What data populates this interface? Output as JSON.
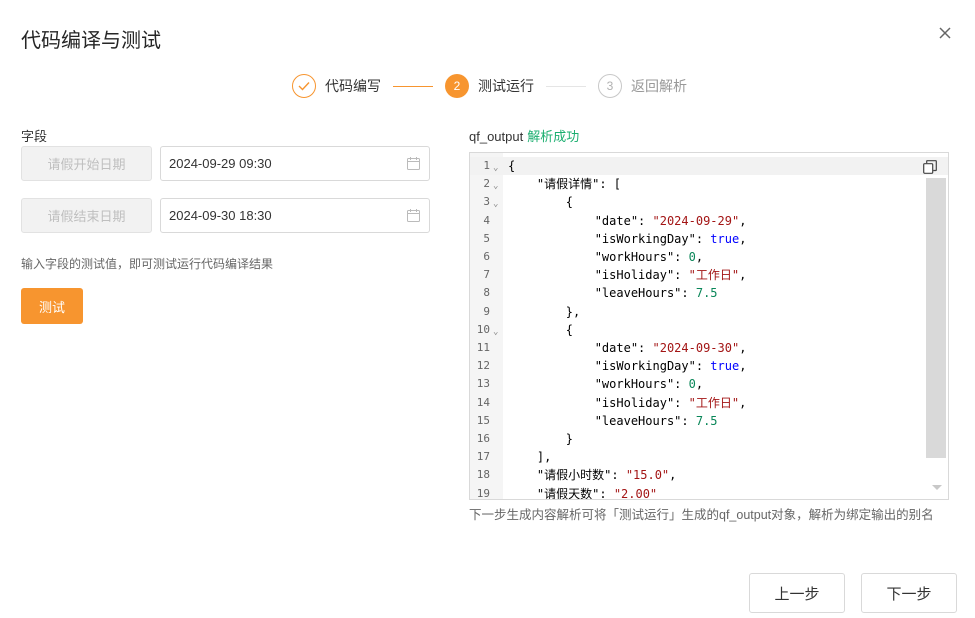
{
  "dialog": {
    "title": "代码编译与测试"
  },
  "steps": [
    {
      "label": "代码编写",
      "number": "1",
      "state": "done"
    },
    {
      "label": "测试运行",
      "number": "2",
      "state": "active"
    },
    {
      "label": "返回解析",
      "number": "3",
      "state": "todo"
    }
  ],
  "left": {
    "field_label": "字段",
    "params": [
      {
        "button": "请假开始日期",
        "value": "2024-09-29 09:30"
      },
      {
        "button": "请假结束日期",
        "value": "2024-09-30 18:30"
      }
    ],
    "hint": "输入字段的测试值，即可测试运行代码编译结果",
    "test_button": "测试"
  },
  "right": {
    "output_label": "qf_output",
    "status": "解析成功",
    "description": "下一步生成内容解析可将「测试运行」生成的qf_output对象，解析为绑定输出的别名"
  },
  "code_lines": [
    {
      "n": "1",
      "fold": true,
      "indent": 0,
      "parts": [
        [
          "p",
          "{"
        ]
      ]
    },
    {
      "n": "2",
      "fold": true,
      "indent": 1,
      "parts": [
        [
          "p",
          "\"请假详情\": ["
        ]
      ]
    },
    {
      "n": "3",
      "fold": true,
      "indent": 2,
      "parts": [
        [
          "p",
          "{"
        ]
      ]
    },
    {
      "n": "4",
      "fold": false,
      "indent": 3,
      "parts": [
        [
          "p",
          "\"date\": "
        ],
        [
          "s",
          "\"2024-09-29\""
        ],
        [
          "p",
          ","
        ]
      ]
    },
    {
      "n": "5",
      "fold": false,
      "indent": 3,
      "parts": [
        [
          "p",
          "\"isWorkingDay\": "
        ],
        [
          "k",
          "true"
        ],
        [
          "p",
          ","
        ]
      ]
    },
    {
      "n": "6",
      "fold": false,
      "indent": 3,
      "parts": [
        [
          "p",
          "\"workHours\": "
        ],
        [
          "d",
          "0"
        ],
        [
          "p",
          ","
        ]
      ]
    },
    {
      "n": "7",
      "fold": false,
      "indent": 3,
      "parts": [
        [
          "p",
          "\"isHoliday\": "
        ],
        [
          "s",
          "\"工作日\""
        ],
        [
          "p",
          ","
        ]
      ]
    },
    {
      "n": "8",
      "fold": false,
      "indent": 3,
      "parts": [
        [
          "p",
          "\"leaveHours\": "
        ],
        [
          "d",
          "7.5"
        ]
      ]
    },
    {
      "n": "9",
      "fold": false,
      "indent": 2,
      "parts": [
        [
          "p",
          "},"
        ]
      ]
    },
    {
      "n": "10",
      "fold": true,
      "indent": 2,
      "parts": [
        [
          "p",
          "{"
        ]
      ]
    },
    {
      "n": "11",
      "fold": false,
      "indent": 3,
      "parts": [
        [
          "p",
          "\"date\": "
        ],
        [
          "s",
          "\"2024-09-30\""
        ],
        [
          "p",
          ","
        ]
      ]
    },
    {
      "n": "12",
      "fold": false,
      "indent": 3,
      "parts": [
        [
          "p",
          "\"isWorkingDay\": "
        ],
        [
          "k",
          "true"
        ],
        [
          "p",
          ","
        ]
      ]
    },
    {
      "n": "13",
      "fold": false,
      "indent": 3,
      "parts": [
        [
          "p",
          "\"workHours\": "
        ],
        [
          "d",
          "0"
        ],
        [
          "p",
          ","
        ]
      ]
    },
    {
      "n": "14",
      "fold": false,
      "indent": 3,
      "parts": [
        [
          "p",
          "\"isHoliday\": "
        ],
        [
          "s",
          "\"工作日\""
        ],
        [
          "p",
          ","
        ]
      ]
    },
    {
      "n": "15",
      "fold": false,
      "indent": 3,
      "parts": [
        [
          "p",
          "\"leaveHours\": "
        ],
        [
          "d",
          "7.5"
        ]
      ]
    },
    {
      "n": "16",
      "fold": false,
      "indent": 2,
      "parts": [
        [
          "p",
          "}"
        ]
      ]
    },
    {
      "n": "17",
      "fold": false,
      "indent": 1,
      "parts": [
        [
          "p",
          "],"
        ]
      ]
    },
    {
      "n": "18",
      "fold": false,
      "indent": 1,
      "parts": [
        [
          "p",
          "\"请假小时数\": "
        ],
        [
          "s",
          "\"15.0\""
        ],
        [
          "p",
          ","
        ]
      ]
    },
    {
      "n": "19",
      "fold": false,
      "indent": 1,
      "parts": [
        [
          "p",
          "\"请假天数\": "
        ],
        [
          "s",
          "\"2.00\""
        ]
      ]
    }
  ],
  "footer": {
    "prev": "上一步",
    "next": "下一步"
  },
  "icons": {
    "close": "close-icon",
    "calendar": "calendar-icon",
    "copy": "copy-icon",
    "check": "check-icon",
    "fold": "chevron-down-icon"
  },
  "colors": {
    "accent": "#f7952f",
    "success": "#1aae6f",
    "string": "#a31515",
    "keyword": "#0000ff",
    "number": "#098658"
  }
}
